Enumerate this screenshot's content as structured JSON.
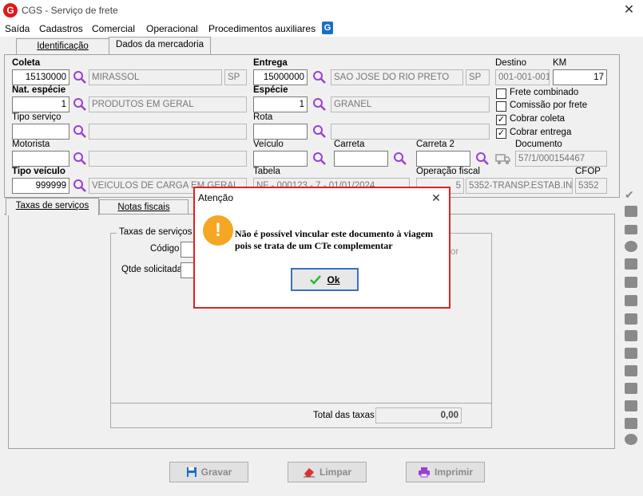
{
  "window": {
    "title": "CGS - Serviço de frete",
    "close_glyph": "✕",
    "logo_letter": "G"
  },
  "menu": {
    "items": [
      "Saída",
      "Cadastros",
      "Comercial",
      "Operacional",
      "Procedimentos auxiliares"
    ],
    "help_glyph": "G"
  },
  "tabs_top": [
    "Identificação",
    "Dados da mercadoria"
  ],
  "form": {
    "coleta": {
      "label": "Coleta",
      "code": "15130000",
      "city": "MIRASSOL",
      "uf": "SP"
    },
    "entrega": {
      "label": "Entrega",
      "code": "15000000",
      "city": "SAO JOSE DO RIO PRETO",
      "uf": "SP"
    },
    "destino": {
      "label": "Destino",
      "value": "001-001-001"
    },
    "km": {
      "label": "KM",
      "value": "17"
    },
    "nat_especie": {
      "label": "Nat. espécie",
      "code": "1",
      "desc": "PRODUTOS EM GERAL"
    },
    "especie": {
      "label": "Espécie",
      "code": "1",
      "desc": "GRANEL"
    },
    "tipo_servico": {
      "label": "Tipo serviço"
    },
    "rota": {
      "label": "Rota"
    },
    "motorista": {
      "label": "Motorista"
    },
    "veiculo": {
      "label": "Veículo"
    },
    "carreta": {
      "label": "Carreta"
    },
    "carreta2": {
      "label": "Carreta 2"
    },
    "documento": {
      "label": "Documento",
      "value": "57/1/000154467"
    },
    "tipo_veiculo": {
      "label": "Tipo veículo",
      "code": "999999",
      "desc": "VEICULOS DE CARGA EM GERAL"
    },
    "tabela": {
      "label": "Tabela",
      "value": "NF - 000123 - 7 - 01/01/2024"
    },
    "operacao_fiscal": {
      "label": "Operação fiscal",
      "code": "5",
      "desc": "5352-TRANSP.ESTAB.IND"
    },
    "cfop": {
      "label": "CFOP",
      "value": "5352"
    },
    "checks": [
      {
        "label": "Frete combinado",
        "checked": false
      },
      {
        "label": "Comissão por frete",
        "checked": false
      },
      {
        "label": "Cobrar coleta",
        "checked": true
      },
      {
        "label": "Cobrar entrega",
        "checked": true
      }
    ]
  },
  "tabs_bottom": [
    "Taxas de serviços",
    "Notas fiscais"
  ],
  "taxas": {
    "group_title": "Taxas de serviços",
    "codigo_label": "Código",
    "qtde_label": "Qtde solicitada",
    "partial_text": "or",
    "total_label": "Total das taxas",
    "total_value": "0,00"
  },
  "buttons": {
    "gravar": "Gravar",
    "limpar": "Limpar",
    "imprimir": "Imprimir"
  },
  "dialog": {
    "title": "Atenção",
    "icon_glyph": "!",
    "message": "Não é possível vincular este documento à viagem pois se trata de um CTe complementar",
    "ok_label": "Ok",
    "close_glyph": "✕"
  },
  "colors": {
    "dialog_border": "#e02020",
    "warning": "#f5a623",
    "search_icon": "#9b3fd1",
    "ok_accent": "#3b6fc0"
  }
}
